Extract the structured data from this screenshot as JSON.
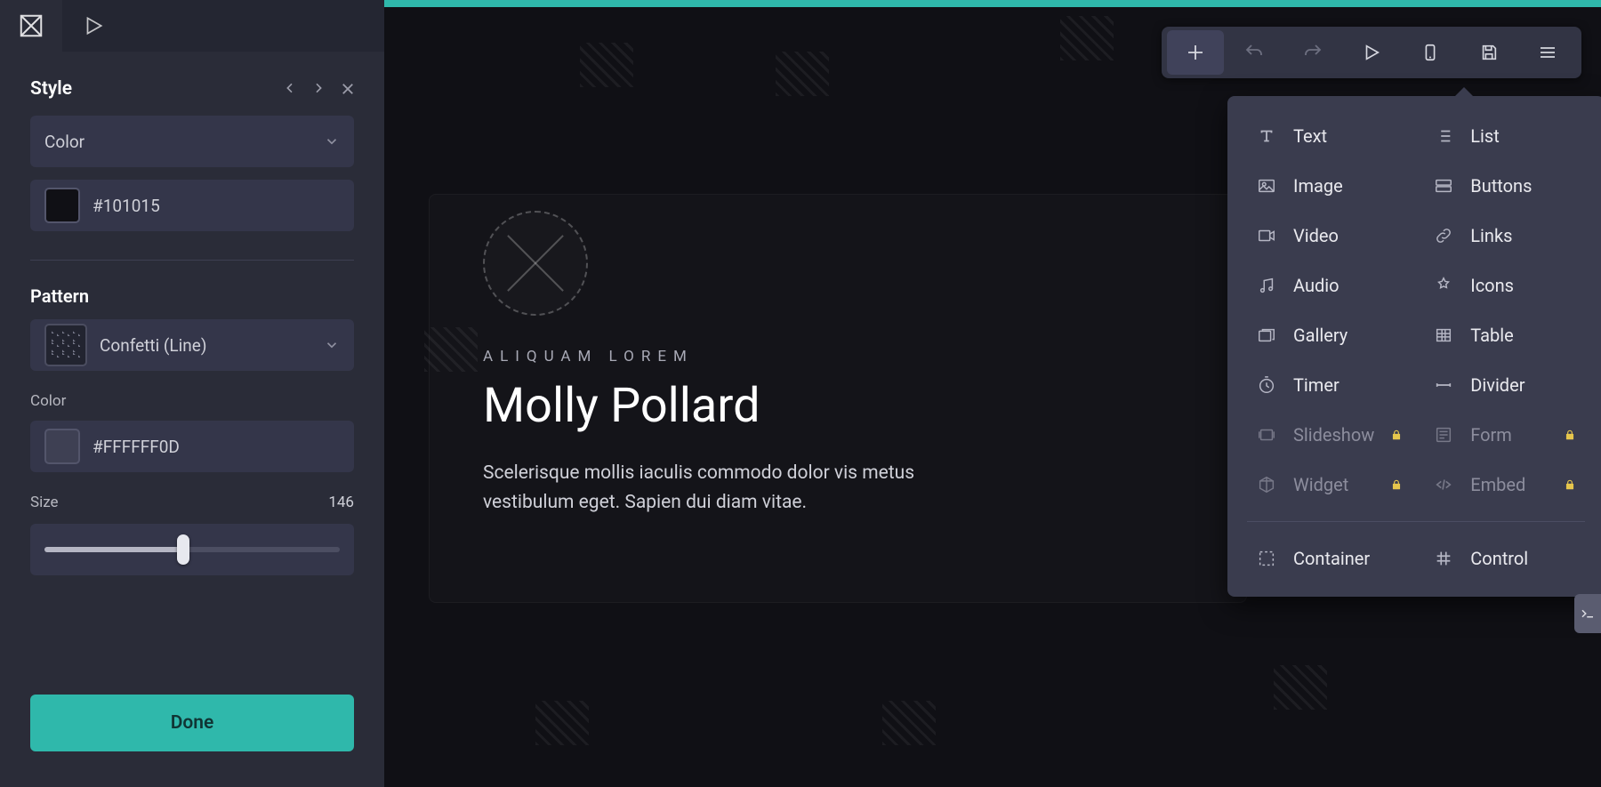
{
  "sidebar": {
    "panel_title": "Style",
    "style": {
      "mode_label": "Color",
      "color_value": "#101015"
    },
    "pattern_section_label": "Pattern",
    "pattern": {
      "name": "Confetti (Line)",
      "color_label": "Color",
      "color_value": "#FFFFFF0D",
      "size_label": "Size",
      "size_value": "146",
      "size_percent": 47
    },
    "done_label": "Done"
  },
  "toolbar": {
    "add_active": true
  },
  "add_menu": {
    "left": [
      {
        "key": "text",
        "label": "Text",
        "locked": false
      },
      {
        "key": "image",
        "label": "Image",
        "locked": false
      },
      {
        "key": "video",
        "label": "Video",
        "locked": false
      },
      {
        "key": "audio",
        "label": "Audio",
        "locked": false
      },
      {
        "key": "gallery",
        "label": "Gallery",
        "locked": false
      },
      {
        "key": "timer",
        "label": "Timer",
        "locked": false
      },
      {
        "key": "slideshow",
        "label": "Slideshow",
        "locked": true
      },
      {
        "key": "widget",
        "label": "Widget",
        "locked": true
      }
    ],
    "right": [
      {
        "key": "list",
        "label": "List",
        "locked": false
      },
      {
        "key": "buttons",
        "label": "Buttons",
        "locked": false
      },
      {
        "key": "links",
        "label": "Links",
        "locked": false
      },
      {
        "key": "icons",
        "label": "Icons",
        "locked": false
      },
      {
        "key": "table",
        "label": "Table",
        "locked": false
      },
      {
        "key": "divider",
        "label": "Divider",
        "locked": false
      },
      {
        "key": "form",
        "label": "Form",
        "locked": true
      },
      {
        "key": "embed",
        "label": "Embed",
        "locked": true
      }
    ],
    "footer": [
      {
        "key": "container",
        "label": "Container",
        "locked": false
      },
      {
        "key": "control",
        "label": "Control",
        "locked": false
      }
    ]
  },
  "page": {
    "overline": "Aliquam Lorem",
    "heading": "Molly Pollard",
    "body": "Scelerisque mollis iaculis commodo dolor vis metus vestibulum eget. Sapien dui diam vitae."
  },
  "colors": {
    "accent": "#2fb8ab",
    "style_swatch": "#101015",
    "pattern_swatch": "#FFFFFF0D"
  }
}
